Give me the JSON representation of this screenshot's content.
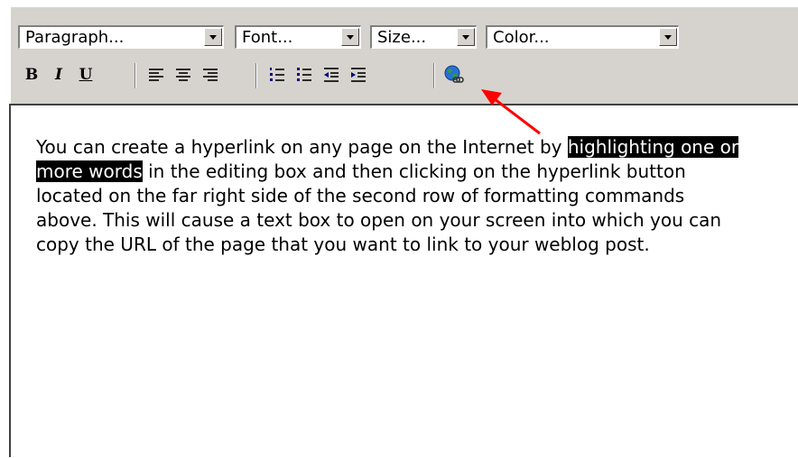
{
  "toolbar": {
    "paragraph_value": "Paragraph...",
    "font_value": "Font...",
    "size_value": "Size...",
    "color_value": "Color...",
    "bold_label": "B",
    "italic_label": "I",
    "underline_label": "U"
  },
  "editor": {
    "text_before": "You can create a hyperlink on any page on the Internet by ",
    "highlighted": "highlighting one or more words",
    "text_after": " in the editing box and then clicking on the hyperlink button located on the far right side of the second row of formatting commands above. This will cause a text box to open on your screen into which you can copy the URL of the page that you want to link to your weblog post."
  },
  "colors": {
    "toolbar_bg": "#d6d3ce",
    "annotation_arrow": "#ff0000",
    "selection_bg": "#000000"
  },
  "icons": [
    "chevron-down-icon",
    "align-left-icon",
    "align-center-icon",
    "align-right-icon",
    "numbered-list-icon",
    "bulleted-list-icon",
    "outdent-icon",
    "indent-icon",
    "hyperlink-globe-icon",
    "annotation-arrow-icon"
  ]
}
